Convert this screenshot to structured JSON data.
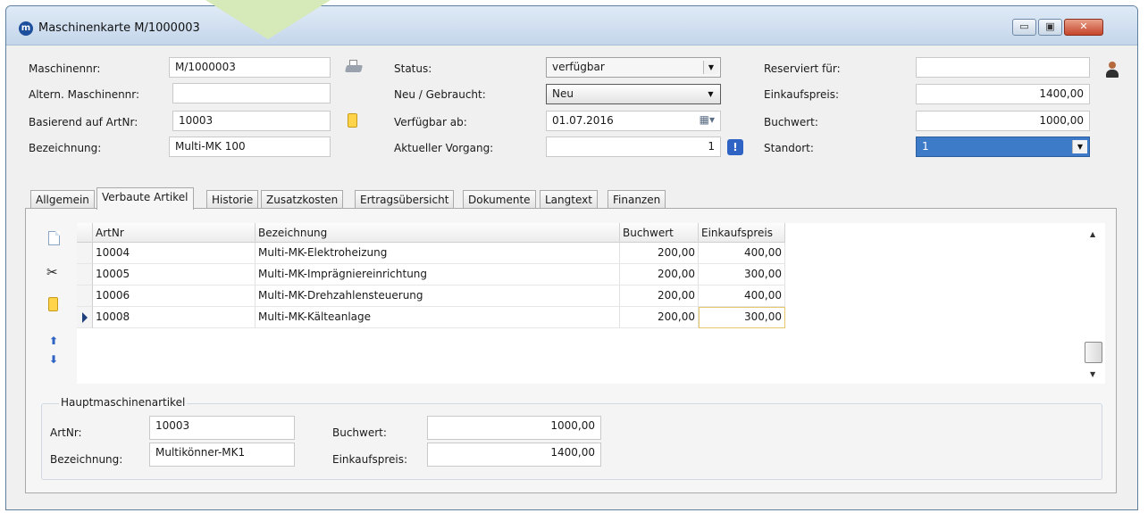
{
  "window": {
    "title": "Maschinenkarte M/1000003",
    "logo_letter": "m",
    "min_glyph": "▭",
    "max_glyph": "▣",
    "close_glyph": "✕"
  },
  "header": {
    "maschinennr": {
      "label": "Maschinennr:",
      "value": "M/1000003"
    },
    "altern_maschinennr": {
      "label": "Altern. Maschinennr:",
      "value": ""
    },
    "basierend_auf_artnr": {
      "label": "Basierend auf ArtNr:",
      "value": "10003"
    },
    "bezeichnung": {
      "label": "Bezeichnung:",
      "value": "Multi-MK 100"
    },
    "status": {
      "label": "Status:",
      "value": "verfügbar"
    },
    "neu_gebraucht": {
      "label": "Neu / Gebraucht:",
      "value": "Neu"
    },
    "verfuegbar_ab": {
      "label": "Verfügbar ab:",
      "value": "01.07.2016"
    },
    "aktueller_vorgang": {
      "label": "Aktueller Vorgang:",
      "value": "1"
    },
    "reserviert_fuer": {
      "label": "Reserviert für:",
      "value": ""
    },
    "einkaufspreis": {
      "label": "Einkaufspreis:",
      "value": "1400,00"
    },
    "buchwert": {
      "label": "Buchwert:",
      "value": "1000,00"
    },
    "standort": {
      "label": "Standort:",
      "value": "1"
    },
    "info_glyph": "!"
  },
  "tabs": [
    {
      "label": "Allgemein"
    },
    {
      "label": "Verbaute Artikel",
      "active": true
    },
    {
      "label": "Historie"
    },
    {
      "label": "Zusatzkosten"
    },
    {
      "label": "Ertragsübersicht"
    },
    {
      "label": "Dokumente"
    },
    {
      "label": "Langtext"
    },
    {
      "label": "Finanzen"
    }
  ],
  "toolbar_icons": {
    "scissors": "✂",
    "up_arrow": "⬆",
    "down_arrow": "⬇"
  },
  "table": {
    "columns": [
      "ArtNr",
      "Bezeichnung",
      "Buchwert",
      "Einkaufspreis"
    ],
    "rows": [
      {
        "artnr": "10004",
        "bezeichnung": "Multi-MK-Elektroheizung",
        "buchwert": "200,00",
        "einkaufspreis": "400,00"
      },
      {
        "artnr": "10005",
        "bezeichnung": "Multi-MK-Imprägniereinrichtung",
        "buchwert": "200,00",
        "einkaufspreis": "300,00"
      },
      {
        "artnr": "10006",
        "bezeichnung": "Multi-MK-Drehzahlensteuerung",
        "buchwert": "200,00",
        "einkaufspreis": "400,00"
      },
      {
        "artnr": "10008",
        "bezeichnung": "Multi-MK-Kälteanlage",
        "buchwert": "200,00",
        "einkaufspreis": "300,00"
      }
    ],
    "current_row": 3,
    "scroll_up": "▲",
    "scroll_down": "▼"
  },
  "hauptmaschinenartikel": {
    "title": "Hauptmaschinenartikel",
    "artnr": {
      "label": "ArtNr:",
      "value": "10003"
    },
    "bezeichnung": {
      "label": "Bezeichnung:",
      "value": "Multikönner-MK1"
    },
    "buchwert": {
      "label": "Buchwert:",
      "value": "1000,00"
    },
    "einkaufspreis": {
      "label": "Einkaufspreis:",
      "value": "1400,00"
    }
  },
  "dropdown_glyph": "▼",
  "calendar_glyph": "▦▾"
}
